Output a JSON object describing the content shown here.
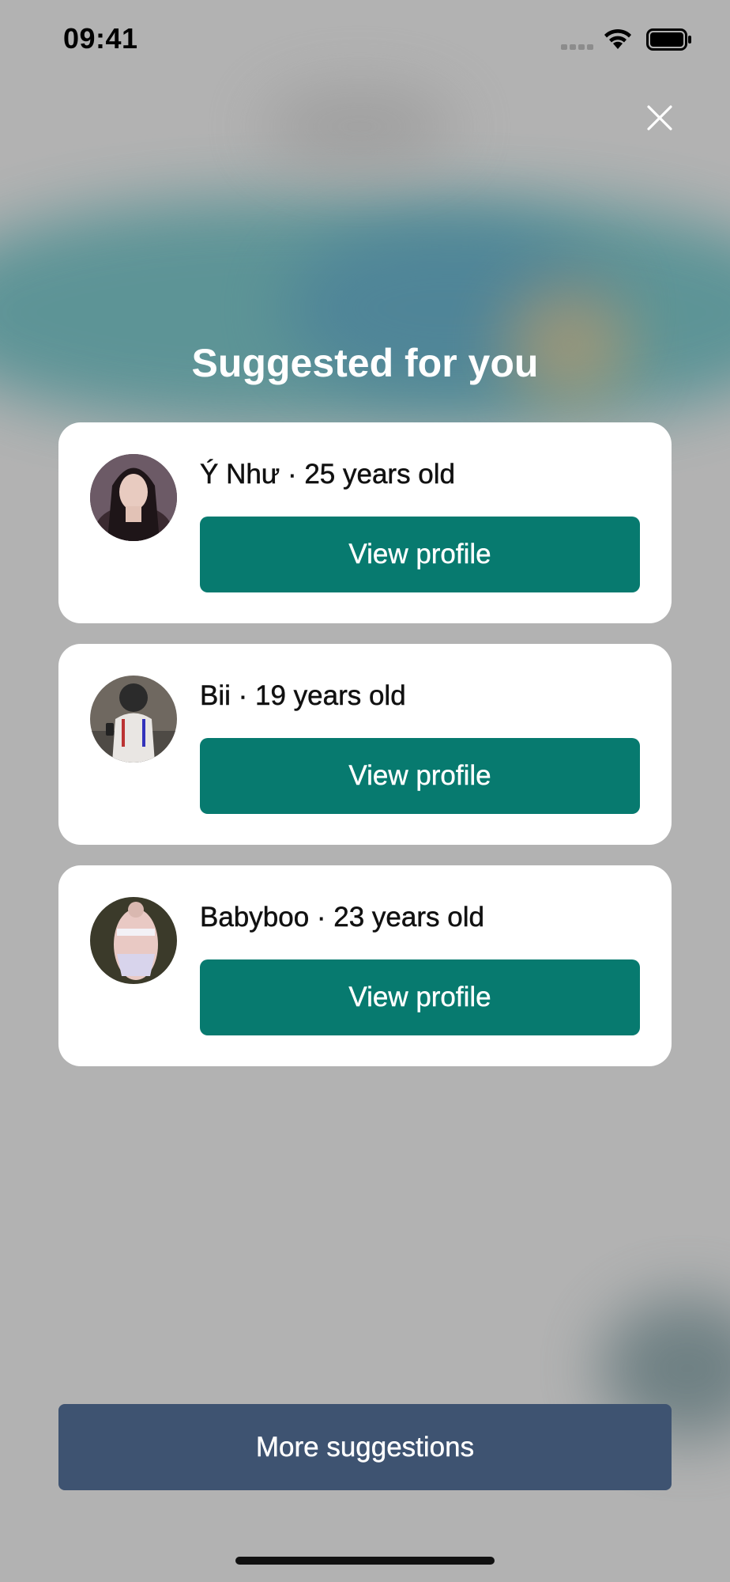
{
  "status_bar": {
    "time": "09:41"
  },
  "header": {
    "title": "Suggested for you",
    "close_icon": "close-icon"
  },
  "suggestions": [
    {
      "name_line": "Ý Như · 25 years old",
      "button_label": "View profile"
    },
    {
      "name_line": "Bii · 19 years old",
      "button_label": "View profile"
    },
    {
      "name_line": "Babyboo · 23 years old",
      "button_label": "View profile"
    }
  ],
  "footer": {
    "more_label": "More suggestions"
  },
  "colors": {
    "primary_button": "#077a6f",
    "secondary_button": "#3e5371",
    "overlay_background": "#b2b2b2"
  }
}
